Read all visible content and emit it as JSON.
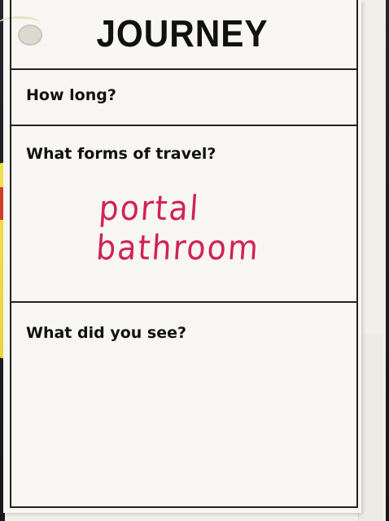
{
  "card": {
    "title": "JOURNEY",
    "questions": [
      {
        "label": "How long?"
      },
      {
        "label": "What forms of travel?"
      },
      {
        "label": "What did you see?"
      }
    ],
    "answer_handwritten": "portal bathroom"
  },
  "colors": {
    "ink": "#111111",
    "handwriting": "#d0225a",
    "card": "#f7f6f3",
    "background": "#1a1d22",
    "sticky_note": "#f3e14b"
  }
}
